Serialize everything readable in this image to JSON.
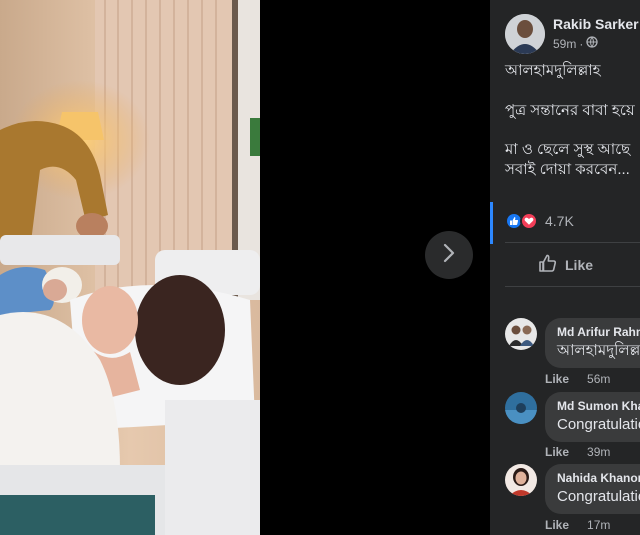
{
  "photo_viewer": {
    "next_icon": "chevron-right-icon"
  },
  "post": {
    "author": "Rakib Sarker",
    "time": "59m",
    "separator": "·",
    "privacy_icon": "globe-icon",
    "lines": [
      "আলহামদুলিল্লাহ",
      "পুত্র সন্তানের বাবা হয়ে",
      "মা ও ছেলে সুস্থ আছে",
      "সবাই দোয়া করবেন..."
    ],
    "reactions": {
      "count": "4.7K",
      "icons": [
        "like-reaction-icon",
        "love-reaction-icon"
      ]
    },
    "like_label": "Like"
  },
  "comments": [
    {
      "name": "Md Arifur Rahm",
      "text": "আলহামদুলিল্ল",
      "like": "Like",
      "time": "56m"
    },
    {
      "name": "Md Sumon Kha",
      "text": "Congratulation",
      "like": "Like",
      "time": "39m"
    },
    {
      "name": "Nahida Khanom",
      "text": "Congratulation",
      "like": "Like",
      "time": "17m"
    }
  ],
  "colors": {
    "panel_bg": "#242526",
    "bubble_bg": "#3a3b3c",
    "accent": "#2d88ff",
    "like_blue": "#1877f2",
    "love_red": "#f33e58"
  }
}
